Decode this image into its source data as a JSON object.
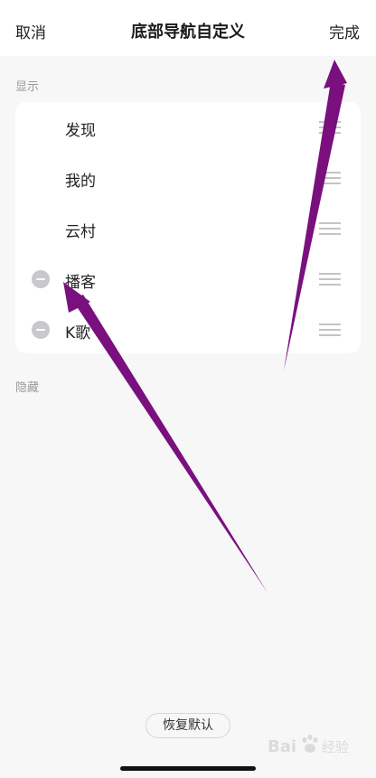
{
  "navbar": {
    "cancel_label": "取消",
    "title": "底部导航自定义",
    "done_label": "完成"
  },
  "shown_section": {
    "label": "显示",
    "items": [
      {
        "label": "发现",
        "removable": false
      },
      {
        "label": "我的",
        "removable": false
      },
      {
        "label": "云村",
        "removable": false
      },
      {
        "label": "播客",
        "removable": true
      },
      {
        "label": "K歌",
        "removable": true
      }
    ]
  },
  "hidden_section": {
    "label": "隐藏",
    "items": []
  },
  "footer": {
    "restore_label": "恢复默认"
  },
  "watermark_text": "Bai 经验",
  "icons": {
    "remove": "minus-circle-icon",
    "reorder": "drag-handle-icon"
  },
  "colors": {
    "annotation_arrow": "#7a0f7e",
    "background": "#f7f7f8"
  }
}
